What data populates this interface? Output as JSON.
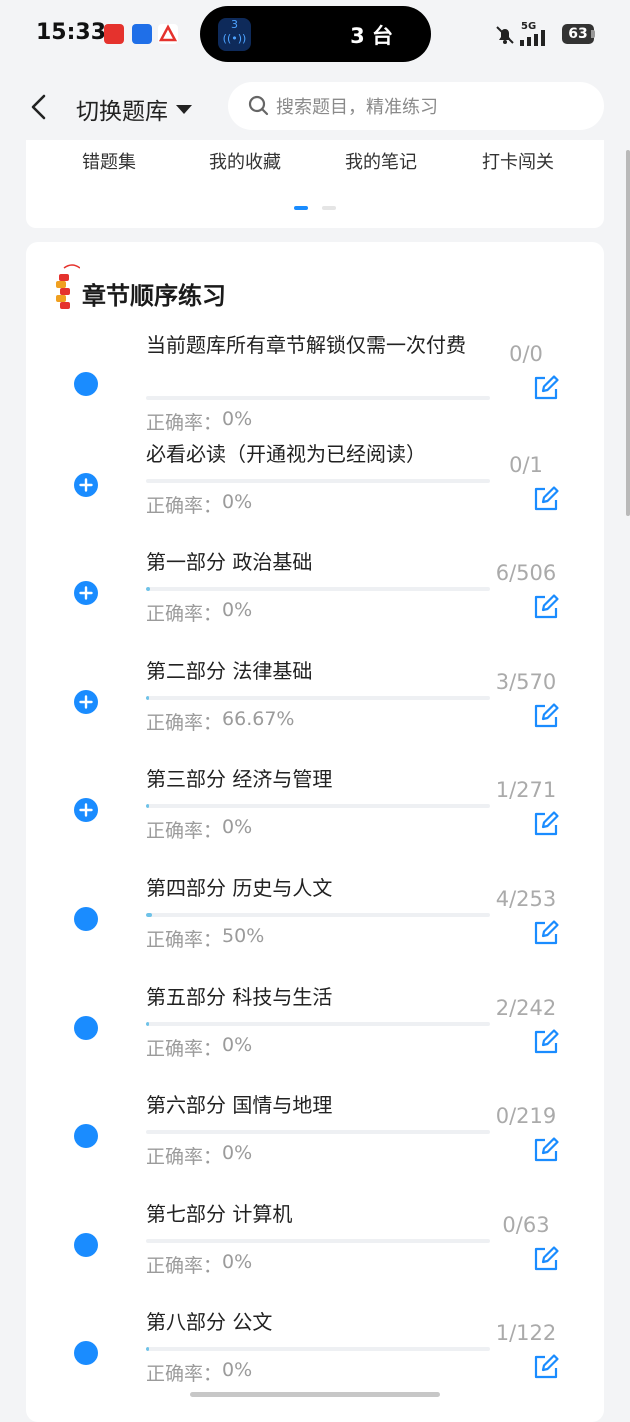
{
  "status_bar": {
    "time": "15:33",
    "island_badge": "3",
    "island_text": "3 台",
    "battery": "63",
    "network": "5G"
  },
  "header": {
    "title": "切换题库",
    "search_placeholder": "搜索题目，精准练习"
  },
  "quick_tabs": [
    {
      "label": "错题集"
    },
    {
      "label": "我的收藏"
    },
    {
      "label": "我的笔记"
    },
    {
      "label": "打卡闯关"
    }
  ],
  "section": {
    "title": "章节顺序练习",
    "accuracy_label": "正确率："
  },
  "chapters": [
    {
      "title": "当前题库所有章节解锁仅需一次付费",
      "accuracy": "0%",
      "count": "0/0",
      "progress": 0,
      "icon": "filled-circle-icon"
    },
    {
      "title": "必看必读（开通视为已经阅读）",
      "accuracy": "0%",
      "count": "0/1",
      "progress": 0,
      "icon": "plus-circle-icon"
    },
    {
      "title": "第一部分 政治基础",
      "accuracy": "0%",
      "count": "6/506",
      "progress": 0.012,
      "icon": "plus-circle-icon"
    },
    {
      "title": "第二部分 法律基础",
      "accuracy": "66.67%",
      "count": "3/570",
      "progress": 0.005,
      "icon": "plus-circle-icon"
    },
    {
      "title": "第三部分 经济与管理",
      "accuracy": "0%",
      "count": "1/271",
      "progress": 0.004,
      "icon": "plus-circle-icon"
    },
    {
      "title": "第四部分 历史与人文",
      "accuracy": "50%",
      "count": "4/253",
      "progress": 0.016,
      "icon": "filled-circle-icon"
    },
    {
      "title": "第五部分 科技与生活",
      "accuracy": "0%",
      "count": "2/242",
      "progress": 0.008,
      "icon": "filled-circle-icon"
    },
    {
      "title": "第六部分 国情与地理",
      "accuracy": "0%",
      "count": "0/219",
      "progress": 0,
      "icon": "filled-circle-icon"
    },
    {
      "title": "第七部分 计算机",
      "accuracy": "0%",
      "count": "0/63",
      "progress": 0,
      "icon": "filled-circle-icon"
    },
    {
      "title": "第八部分 公文",
      "accuracy": "0%",
      "count": "1/122",
      "progress": 0.008,
      "icon": "filled-circle-icon"
    }
  ],
  "colors": {
    "accent": "#1a8cff",
    "progress": "#6ec2e8",
    "muted_text": "#9b9b9b"
  }
}
